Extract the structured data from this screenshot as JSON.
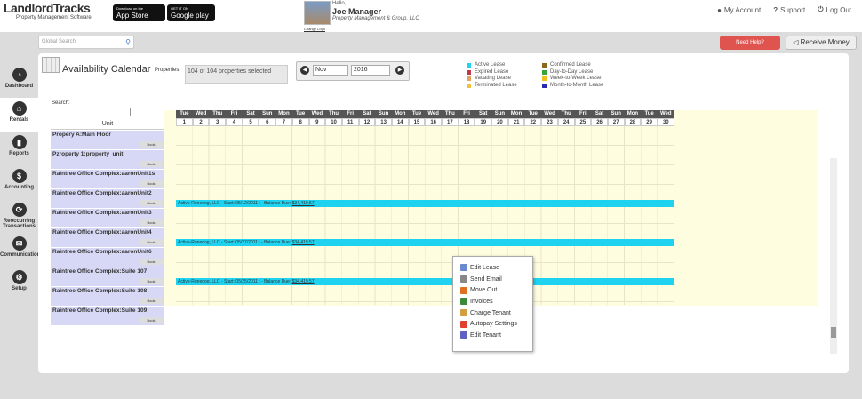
{
  "logo": {
    "main1": "Landlord",
    "main2": "Tracks",
    "sub": "Property Management Software"
  },
  "stores": {
    "apple_top": "Download on the",
    "apple": "App Store",
    "google_top": "GET IT ON",
    "google": "Google play"
  },
  "user": {
    "hello": "Hello,",
    "name": "Joe Manager",
    "org": "Property Management & Group, LLC",
    "change": "Change Logo"
  },
  "toplinks": {
    "account": "My Account",
    "support": "Support",
    "logout": "Log Out"
  },
  "search": {
    "placeholder": "Global Search"
  },
  "buttons": {
    "help": "Need Help?",
    "receive": "Receive Money"
  },
  "nav": [
    {
      "label": "Dashboard",
      "icon": "dashboard-icon"
    },
    {
      "label": "Rentals",
      "icon": "house-icon"
    },
    {
      "label": "Reports",
      "icon": "bar-chart-icon"
    },
    {
      "label": "Accounting",
      "icon": "dollar-icon"
    },
    {
      "label": "Reoccurring Transactions",
      "icon": "refresh-icon"
    },
    {
      "label": "Communication",
      "icon": "mail-icon"
    },
    {
      "label": "Setup",
      "icon": "gear-icon"
    }
  ],
  "calendar": {
    "title": "Availability Calendar",
    "properties_label": "Properties:",
    "properties_value": "104 of 104 properties selected",
    "month": "Nov",
    "year": "2016",
    "search_label": "Search:",
    "unit_header": "Unit"
  },
  "legend": [
    {
      "label": "Active Lease",
      "color": "#1fd3f0"
    },
    {
      "label": "Expired Lease",
      "color": "#c0394b"
    },
    {
      "label": "Vacating Lease",
      "color": "#e8a060"
    },
    {
      "label": "Terminated Lease",
      "color": "#f0c040"
    },
    {
      "label": "Confirmed Lease",
      "color": "#8a6a1a"
    },
    {
      "label": "Day-to-Day Lease",
      "color": "#3aa33a"
    },
    {
      "label": "Week-to-Week Lease",
      "color": "#f0c020"
    },
    {
      "label": "Month-to-Month Lease",
      "color": "#2a2ab0"
    }
  ],
  "days": [
    [
      "Tue",
      "1"
    ],
    [
      "Wed",
      "2"
    ],
    [
      "Thu",
      "3"
    ],
    [
      "Fri",
      "4"
    ],
    [
      "Sat",
      "5"
    ],
    [
      "Sun",
      "6"
    ],
    [
      "Mon",
      "7"
    ],
    [
      "Tue",
      "8"
    ],
    [
      "Wed",
      "9"
    ],
    [
      "Thu",
      "10"
    ],
    [
      "Fri",
      "11"
    ],
    [
      "Sat",
      "12"
    ],
    [
      "Sun",
      "13"
    ],
    [
      "Mon",
      "14"
    ],
    [
      "Tue",
      "15"
    ],
    [
      "Wed",
      "16"
    ],
    [
      "Thu",
      "17"
    ],
    [
      "Fri",
      "18"
    ],
    [
      "Sat",
      "19"
    ],
    [
      "Sun",
      "20"
    ],
    [
      "Mon",
      "21"
    ],
    [
      "Tue",
      "22"
    ],
    [
      "Wed",
      "23"
    ],
    [
      "Thu",
      "24"
    ],
    [
      "Fri",
      "25"
    ],
    [
      "Sat",
      "26"
    ],
    [
      "Sun",
      "27"
    ],
    [
      "Mon",
      "28"
    ],
    [
      "Tue",
      "29"
    ],
    [
      "Wed",
      "30"
    ]
  ],
  "units": [
    "Propery A:Main Floor",
    "Pzroperty 1:property_unit",
    "Raintree Office Complex:aaronUnit1s",
    "Raintree Office Complex:aaronUnit2",
    "Raintree Office Complex:aaronUnit3",
    "Raintree Office Complex:aaronUnit4",
    "Raintree Office Complex:aaronUnit6",
    "Raintree Office Complex:Suite 107",
    "Raintree Office Complex:Suite 108",
    "Raintree Office Complex:Suite 109"
  ],
  "book_label": "Book",
  "leases": [
    {
      "text": "Active-Ronedog, LLC - Start: 05/12/2011    : - Balance Due: ",
      "due": "$34,419.57"
    },
    {
      "text": "Active-Ronedog, LLC - Start: 05/27/2011    : - Balance Due: ",
      "due": "$34,419.57"
    },
    {
      "text": "Active-Ronedog, LLC - Start: 05/25/2011    : - Balance Due: ",
      "due": "$34,419.57"
    }
  ],
  "context_menu": [
    {
      "label": "Edit Lease",
      "color": "#6a8ad0"
    },
    {
      "label": "Send Email",
      "color": "#888"
    },
    {
      "label": "Move Out",
      "color": "#e07020"
    },
    {
      "label": "Invoices",
      "color": "#3a8a3a"
    },
    {
      "label": "Charge Tenant",
      "color": "#d0a040"
    },
    {
      "label": "Autopay Settings",
      "color": "#e04030"
    },
    {
      "label": "Edit Tenant",
      "color": "#6060c0"
    }
  ]
}
